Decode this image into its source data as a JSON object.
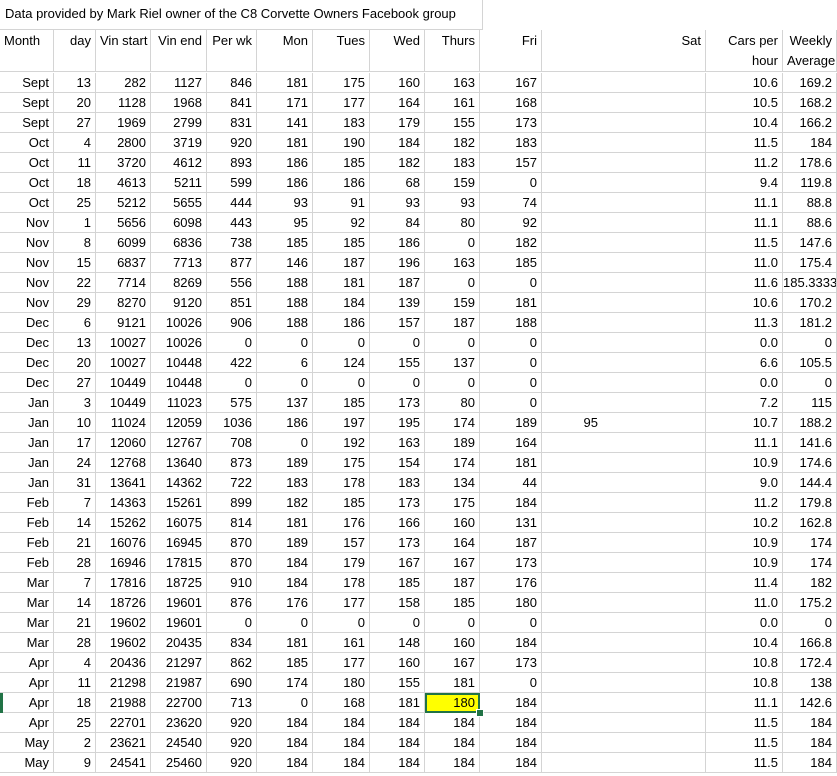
{
  "sheet": {
    "title": "Data provided by Mark Riel owner of the C8 Corvette Owners Facebook group",
    "headers": [
      {
        "l1": "Month",
        "l2": "",
        "align": "left"
      },
      {
        "l1": "day",
        "l2": "",
        "align": "right"
      },
      {
        "l1": "Vin start",
        "l2": "",
        "align": "right"
      },
      {
        "l1": "Vin end",
        "l2": "",
        "align": "right"
      },
      {
        "l1": "Per wk",
        "l2": "",
        "align": "right"
      },
      {
        "l1": "Mon",
        "l2": "",
        "align": "right"
      },
      {
        "l1": "Tues",
        "l2": "",
        "align": "right"
      },
      {
        "l1": "Wed",
        "l2": "",
        "align": "right"
      },
      {
        "l1": "Thurs",
        "l2": "",
        "align": "right"
      },
      {
        "l1": "Fri",
        "l2": "",
        "align": "right"
      },
      {
        "l1": "Sat",
        "l2": "",
        "align": "right"
      },
      {
        "l1": "Cars per",
        "l2": "hour",
        "align": "right"
      },
      {
        "l1": "Weekly",
        "l2": "Average",
        "align": "right"
      }
    ],
    "rows": [
      [
        "Sept",
        "13",
        "282",
        "1127",
        "846",
        "181",
        "175",
        "160",
        "163",
        "167",
        "",
        "10.6",
        "169.2"
      ],
      [
        "Sept",
        "20",
        "1128",
        "1968",
        "841",
        "171",
        "177",
        "164",
        "161",
        "168",
        "",
        "10.5",
        "168.2"
      ],
      [
        "Sept",
        "27",
        "1969",
        "2799",
        "831",
        "141",
        "183",
        "179",
        "155",
        "173",
        "",
        "10.4",
        "166.2"
      ],
      [
        "Oct",
        "4",
        "2800",
        "3719",
        "920",
        "181",
        "190",
        "184",
        "182",
        "183",
        "",
        "11.5",
        "184"
      ],
      [
        "Oct",
        "11",
        "3720",
        "4612",
        "893",
        "186",
        "185",
        "182",
        "183",
        "157",
        "",
        "11.2",
        "178.6"
      ],
      [
        "Oct",
        "18",
        "4613",
        "5211",
        "599",
        "186",
        "186",
        "68",
        "159",
        "0",
        "",
        "9.4",
        "119.8"
      ],
      [
        "Oct",
        "25",
        "5212",
        "5655",
        "444",
        "93",
        "91",
        "93",
        "93",
        "74",
        "",
        "11.1",
        "88.8"
      ],
      [
        "Nov",
        "1",
        "5656",
        "6098",
        "443",
        "95",
        "92",
        "84",
        "80",
        "92",
        "",
        "11.1",
        "88.6"
      ],
      [
        "Nov",
        "8",
        "6099",
        "6836",
        "738",
        "185",
        "185",
        "186",
        "0",
        "182",
        "",
        "11.5",
        "147.6"
      ],
      [
        "Nov",
        "15",
        "6837",
        "7713",
        "877",
        "146",
        "187",
        "196",
        "163",
        "185",
        "",
        "11.0",
        "175.4"
      ],
      [
        "Nov",
        "22",
        "7714",
        "8269",
        "556",
        "188",
        "181",
        "187",
        "0",
        "0",
        "",
        "11.6",
        "185.3333"
      ],
      [
        "Nov",
        "29",
        "8270",
        "9120",
        "851",
        "188",
        "184",
        "139",
        "159",
        "181",
        "",
        "10.6",
        "170.2"
      ],
      [
        "Dec",
        "6",
        "9121",
        "10026",
        "906",
        "188",
        "186",
        "157",
        "187",
        "188",
        "",
        "11.3",
        "181.2"
      ],
      [
        "Dec",
        "13",
        "10027",
        "10026",
        "0",
        "0",
        "0",
        "0",
        "0",
        "0",
        "",
        "0.0",
        "0"
      ],
      [
        "Dec",
        "20",
        "10027",
        "10448",
        "422",
        "6",
        "124",
        "155",
        "137",
        "0",
        "",
        "6.6",
        "105.5"
      ],
      [
        "Dec",
        "27",
        "10449",
        "10448",
        "0",
        "0",
        "0",
        "0",
        "0",
        "0",
        "",
        "0.0",
        "0"
      ],
      [
        "Jan",
        "3",
        "10449",
        "11023",
        "575",
        "137",
        "185",
        "173",
        "80",
        "0",
        "",
        "7.2",
        "115"
      ],
      [
        "Jan",
        "10",
        "11024",
        "12059",
        "1036",
        "186",
        "197",
        "195",
        "174",
        "189",
        "95",
        "10.7",
        "188.2"
      ],
      [
        "Jan",
        "17",
        "12060",
        "12767",
        "708",
        "0",
        "192",
        "163",
        "189",
        "164",
        "",
        "11.1",
        "141.6"
      ],
      [
        "Jan",
        "24",
        "12768",
        "13640",
        "873",
        "189",
        "175",
        "154",
        "174",
        "181",
        "",
        "10.9",
        "174.6"
      ],
      [
        "Jan",
        "31",
        "13641",
        "14362",
        "722",
        "183",
        "178",
        "183",
        "134",
        "44",
        "",
        "9.0",
        "144.4"
      ],
      [
        "Feb",
        "7",
        "14363",
        "15261",
        "899",
        "182",
        "185",
        "173",
        "175",
        "184",
        "",
        "11.2",
        "179.8"
      ],
      [
        "Feb",
        "14",
        "15262",
        "16075",
        "814",
        "181",
        "176",
        "166",
        "160",
        "131",
        "",
        "10.2",
        "162.8"
      ],
      [
        "Feb",
        "21",
        "16076",
        "16945",
        "870",
        "189",
        "157",
        "173",
        "164",
        "187",
        "",
        "10.9",
        "174"
      ],
      [
        "Feb",
        "28",
        "16946",
        "17815",
        "870",
        "184",
        "179",
        "167",
        "167",
        "173",
        "",
        "10.9",
        "174"
      ],
      [
        "Mar",
        "7",
        "17816",
        "18725",
        "910",
        "184",
        "178",
        "185",
        "187",
        "176",
        "",
        "11.4",
        "182"
      ],
      [
        "Mar",
        "14",
        "18726",
        "19601",
        "876",
        "176",
        "177",
        "158",
        "185",
        "180",
        "",
        "11.0",
        "175.2"
      ],
      [
        "Mar",
        "21",
        "19602",
        "19601",
        "0",
        "0",
        "0",
        "0",
        "0",
        "0",
        "",
        "0.0",
        "0"
      ],
      [
        "Mar",
        "28",
        "19602",
        "20435",
        "834",
        "181",
        "161",
        "148",
        "160",
        "184",
        "",
        "10.4",
        "166.8"
      ],
      [
        "Apr",
        "4",
        "20436",
        "21297",
        "862",
        "185",
        "177",
        "160",
        "167",
        "173",
        "",
        "10.8",
        "172.4"
      ],
      [
        "Apr",
        "11",
        "21298",
        "21987",
        "690",
        "174",
        "180",
        "155",
        "181",
        "0",
        "",
        "10.8",
        "138"
      ],
      [
        "Apr",
        "18",
        "21988",
        "22700",
        "713",
        "0",
        "168",
        "181",
        "180",
        "184",
        "",
        "11.1",
        "142.6"
      ],
      [
        "Apr",
        "25",
        "22701",
        "23620",
        "920",
        "184",
        "184",
        "184",
        "184",
        "184",
        "",
        "11.5",
        "184"
      ],
      [
        "May",
        "2",
        "23621",
        "24540",
        "920",
        "184",
        "184",
        "184",
        "184",
        "184",
        "",
        "11.5",
        "184"
      ],
      [
        "May",
        "9",
        "24541",
        "25460",
        "920",
        "184",
        "184",
        "184",
        "184",
        "184",
        "",
        "11.5",
        "184"
      ]
    ],
    "selected_cell": {
      "row": 31,
      "col": 8
    },
    "colors": {
      "gridline": "#d4d4d4",
      "selection_fill": "#ffff00",
      "selection_border": "#217346"
    }
  }
}
